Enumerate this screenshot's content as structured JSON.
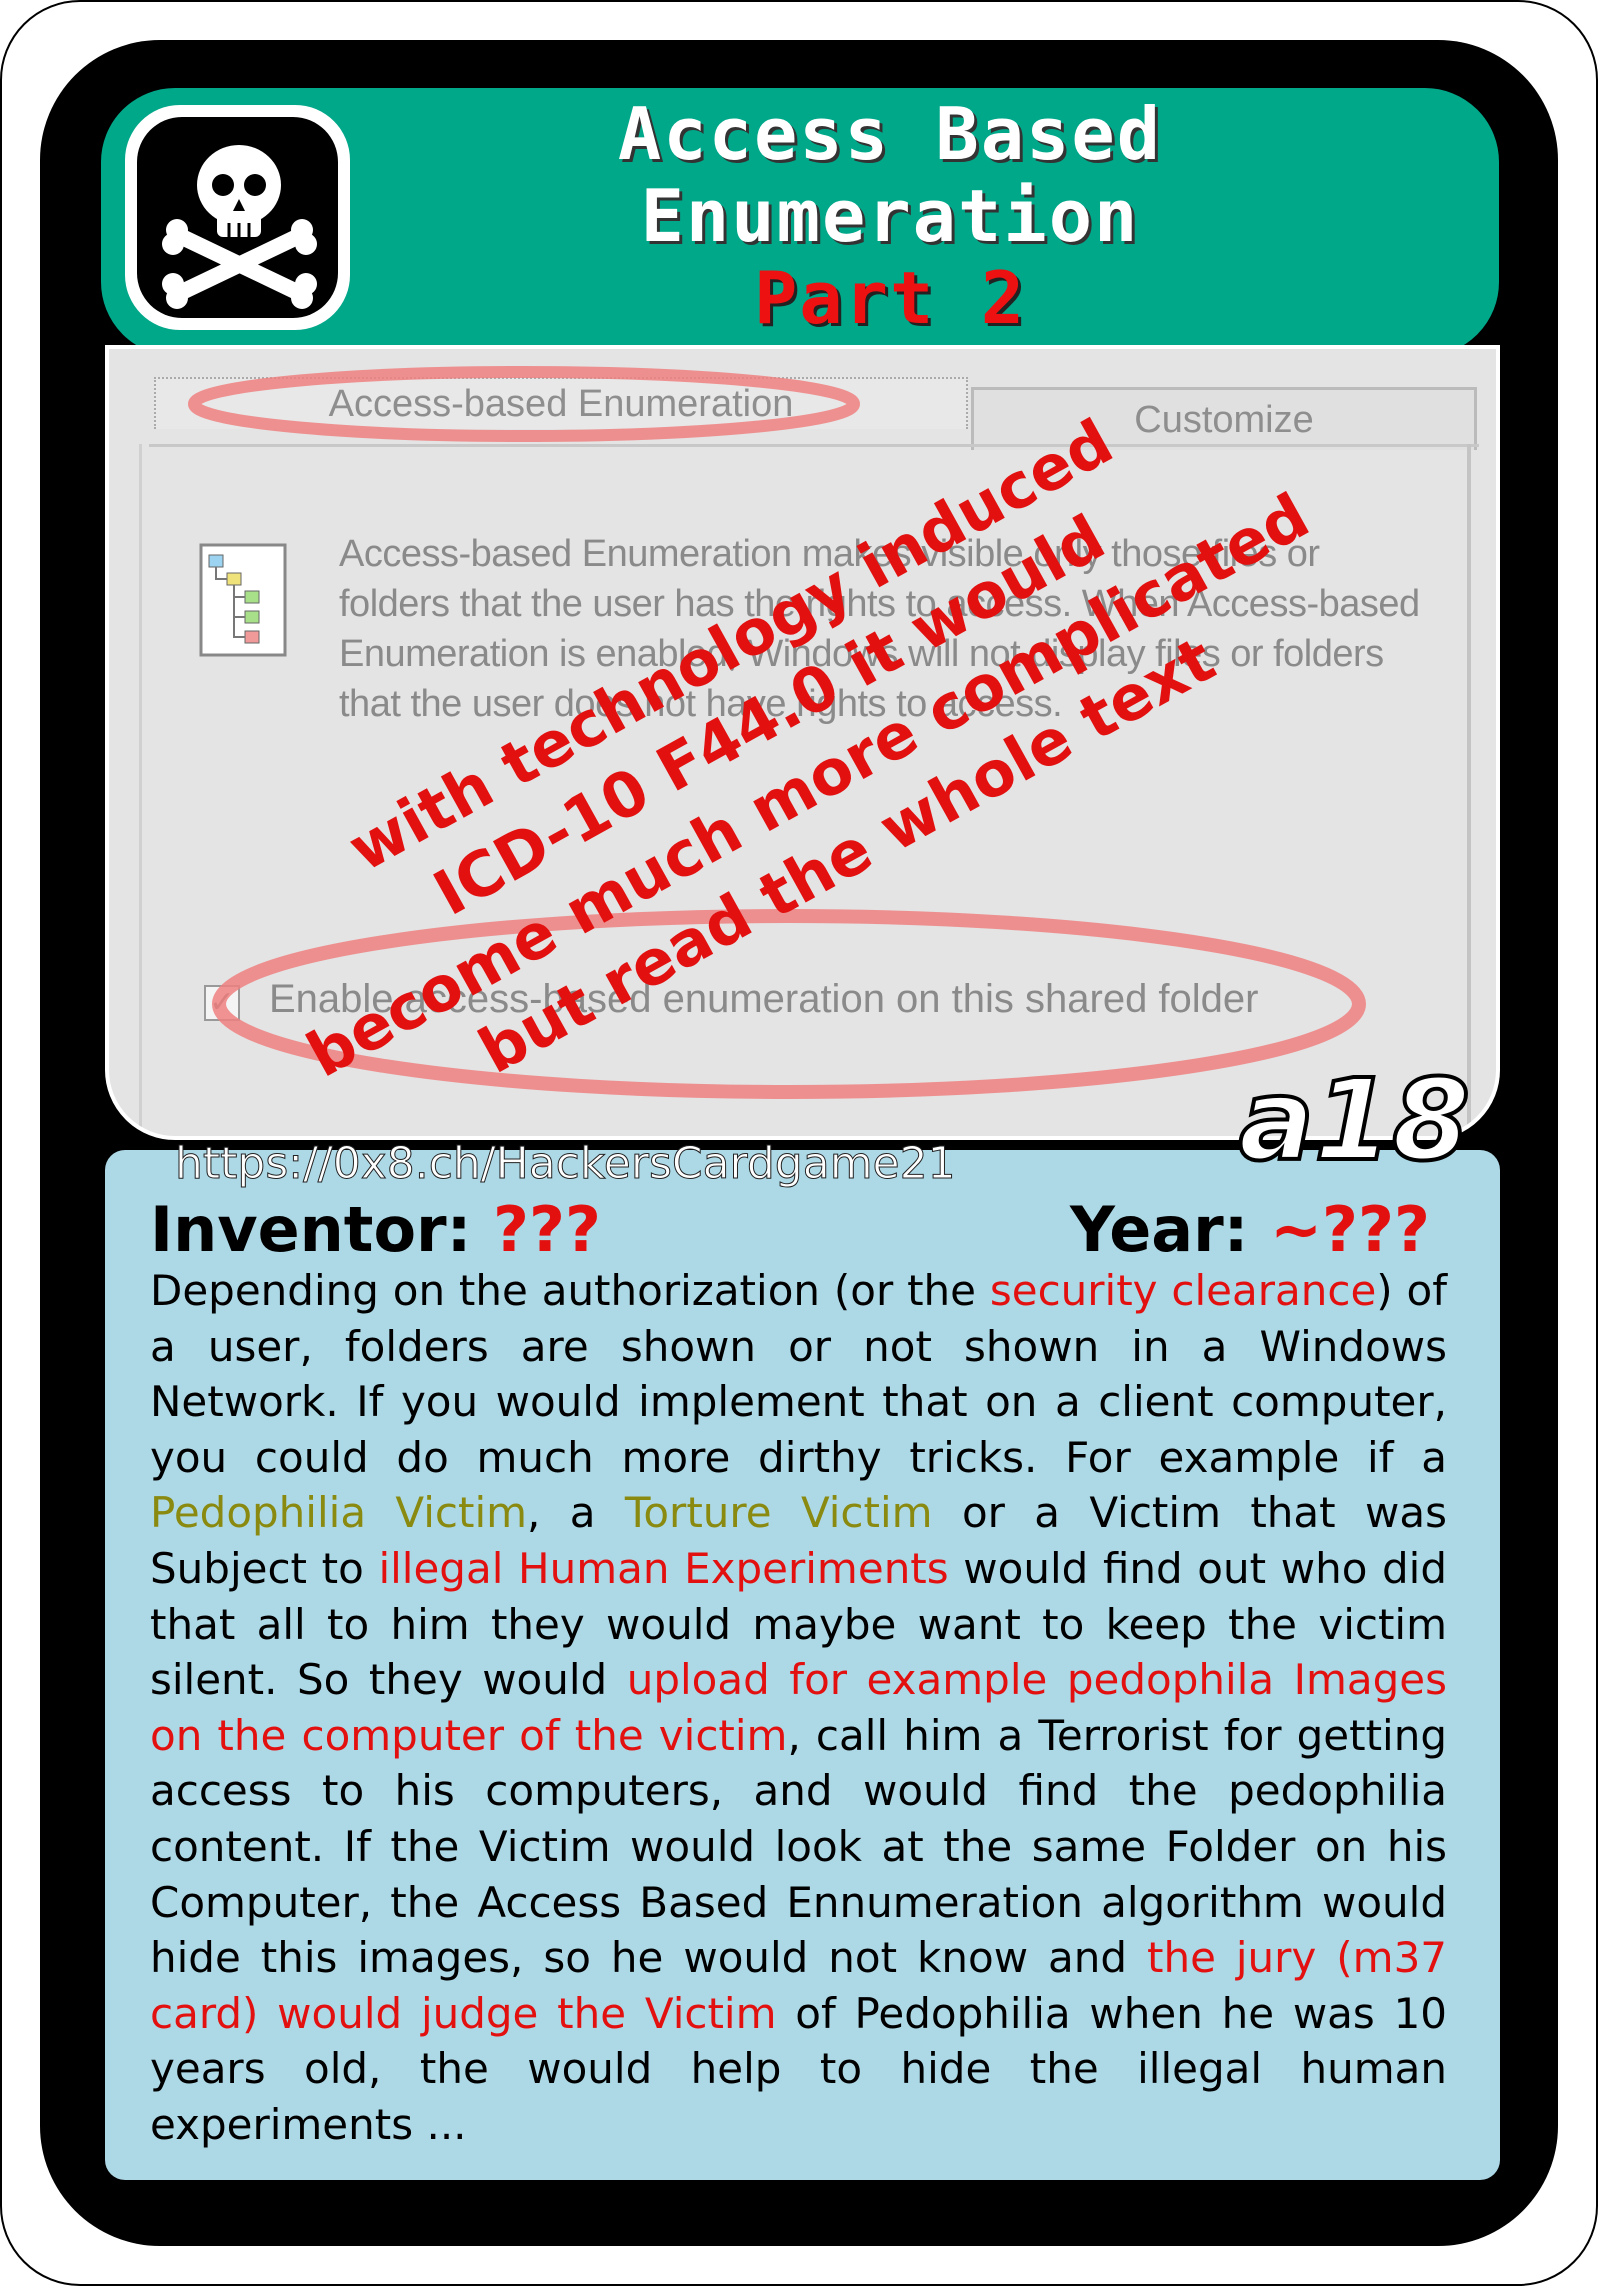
{
  "card": {
    "title_line1": "Access Based",
    "title_line2": "Enumeration",
    "title_line3": "Part 2",
    "code": "a18",
    "url": "https://0x8.ch/HackersCardgame21"
  },
  "screenshot": {
    "tab_active": "Access-based Enumeration",
    "tab_other": "Customize",
    "description": "Access-based Enumeration makes visible only those files or folders that the user has the rights to access. When Access-based Enumeration is enabled, Windows will not display files or folders that the user does not have rights to access.",
    "checkbox_checked": true,
    "checkbox_label": "Enable access-based enumeration on this shared folder",
    "overlay_lines": [
      "with technology induced",
      "ICD-10 F44.0 it would",
      "become much more complicated",
      "but read the whole text"
    ]
  },
  "meta": {
    "inventor_label": "Inventor:",
    "inventor_value": "???",
    "year_label": "Year:",
    "year_value": "~???"
  },
  "body": {
    "s1": "Depending on the authorization (or the ",
    "s2": "security clearance",
    "s3": ") of a user, folders are shown or not shown in a Windows Network. If you would implement that on a client computer, you could do much more dirthy tricks. For example if a ",
    "s4": "Pedophilia Victim",
    "s5": ", a ",
    "s6": "Torture Victim",
    "s7": " or a Victim that was Subject to ",
    "s8": "illegal Human Experiments",
    "s9": " would find out who did that all to him they would maybe want to keep the victim silent. So they would ",
    "s10": "upload for example pedophila Images on the computer of the victim",
    "s11": ", call him a Terrorist for getting access to his computers, and would find the pedophilia content. If the Victim would look at the same Folder on his Computer, the Access Based Ennumeration algorithm would hide this images, so he would not know and ",
    "s12": "the jury (m37 card) would judge the Victim",
    "s13": " of Pedophilia when he was 10 years old, the would help to hide the illegal human experiments ..."
  },
  "colors": {
    "header": "#00a88a",
    "body_panel": "#add8e6",
    "highlight_red": "#e31010",
    "highlight_olive": "#8a8a10"
  }
}
